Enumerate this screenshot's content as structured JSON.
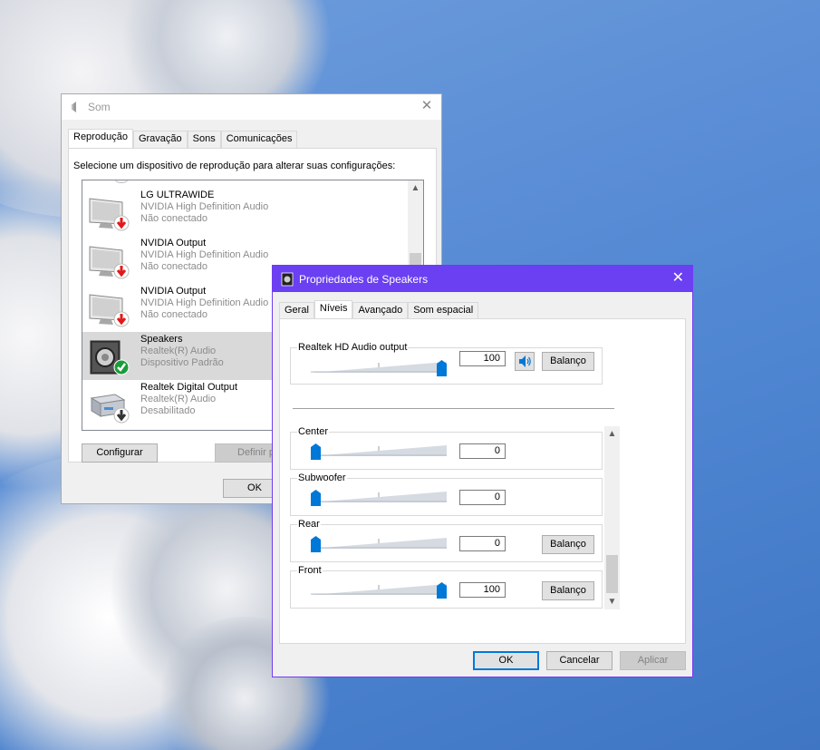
{
  "som": {
    "title": "Som",
    "tabs": [
      "Reprodução",
      "Gravação",
      "Sons",
      "Comunicações"
    ],
    "description": "Selecione um dispositivo de reprodução para alterar suas configurações:",
    "devices": [
      {
        "name": "LG ULTRAWIDE",
        "driver": "NVIDIA High Definition Audio",
        "status": "Não conectado"
      },
      {
        "name": "NVIDIA Output",
        "driver": "NVIDIA High Definition Audio",
        "status": "Não conectado"
      },
      {
        "name": "NVIDIA Output",
        "driver": "NVIDIA High Definition Audio",
        "status": "Não conectado"
      },
      {
        "name": "Speakers",
        "driver": "Realtek(R) Audio",
        "status": "Dispositivo Padrão"
      },
      {
        "name": "Realtek Digital Output",
        "driver": "Realtek(R) Audio",
        "status": "Desabilitado"
      }
    ],
    "buttons": {
      "configure": "Configurar",
      "set_default": "Definir p",
      "ok": "OK"
    }
  },
  "props": {
    "title": "Propriedades de Speakers",
    "tabs": [
      "Geral",
      "Níveis",
      "Avançado",
      "Som espacial"
    ],
    "main": {
      "label": "Realtek HD Audio output",
      "value": "100",
      "level": 1.0,
      "balance": "Balanço"
    },
    "channels": [
      {
        "label": "Center",
        "value": "0",
        "level": 0.0
      },
      {
        "label": "Subwoofer",
        "value": "0",
        "level": 0.0
      },
      {
        "label": "Rear",
        "value": "0",
        "level": 0.0,
        "balance": "Balanço"
      },
      {
        "label": "Front",
        "value": "100",
        "level": 1.0,
        "balance": "Balanço"
      }
    ],
    "buttons": {
      "ok": "OK",
      "cancel": "Cancelar",
      "apply": "Aplicar"
    }
  },
  "colors": {
    "accent": "#0078d7",
    "titlebar": "#6b3ff2",
    "desktop": "#5b8ed6"
  }
}
